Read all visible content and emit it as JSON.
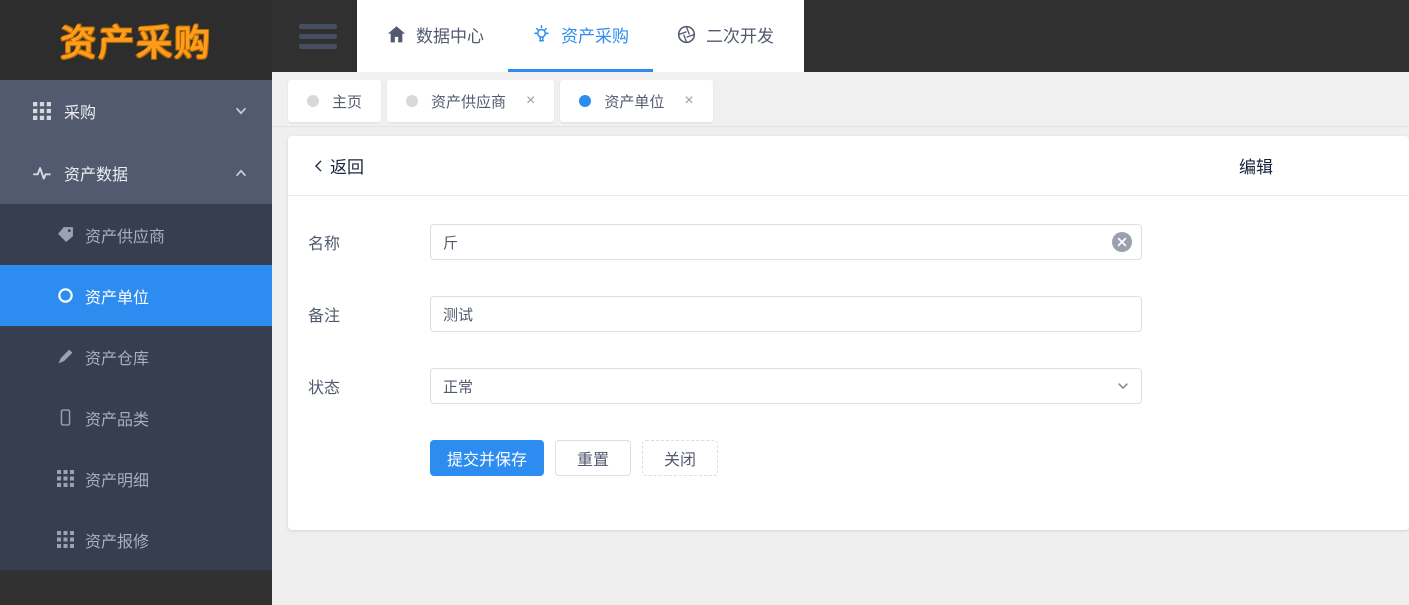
{
  "app": {
    "logo_text": "资产采购"
  },
  "colors": {
    "accent_blue": "#2d8cf0",
    "logo_orange": "#ff9c1c",
    "sidebar_bg": "#515a6e",
    "submenu_bg": "#363e4f",
    "topbar_bg": "#303030",
    "content_bg": "#efefef"
  },
  "topnav": {
    "items": [
      {
        "icon": "home-icon",
        "label": "数据中心",
        "active": false
      },
      {
        "icon": "bulb-icon",
        "label": "资产采购",
        "active": true
      },
      {
        "icon": "aperture-icon",
        "label": "二次开发",
        "active": false
      }
    ]
  },
  "sidebar": {
    "groups": [
      {
        "icon": "grid-icon",
        "label": "采购",
        "state": "collapsed"
      },
      {
        "icon": "pulse-icon",
        "label": "资产数据",
        "state": "expanded"
      }
    ],
    "submenu": [
      {
        "icon": "tag-icon",
        "label": "资产供应商",
        "active": false
      },
      {
        "icon": "circle-icon",
        "label": "资产单位",
        "active": true
      },
      {
        "icon": "pen-icon",
        "label": "资产仓库",
        "active": false
      },
      {
        "icon": "phone-icon",
        "label": "资产品类",
        "active": false
      },
      {
        "icon": "grid-icon",
        "label": "资产明细",
        "active": false
      },
      {
        "icon": "grid-icon",
        "label": "资产报修",
        "active": false
      }
    ]
  },
  "tabbar": {
    "close_glyph": "×",
    "tabs": [
      {
        "label": "主页",
        "active": false,
        "closable": false
      },
      {
        "label": "资产供应商",
        "active": false,
        "closable": true
      },
      {
        "label": "资产单位",
        "active": true,
        "closable": true
      }
    ]
  },
  "panel": {
    "back_label": "返回",
    "edit_label": "编辑"
  },
  "form": {
    "fields": [
      {
        "label": "名称",
        "value": "斤",
        "type": "text-clearable"
      },
      {
        "label": "备注",
        "value": "测试",
        "type": "text"
      },
      {
        "label": "状态",
        "value": "正常",
        "type": "select"
      }
    ],
    "buttons": [
      {
        "label": "提交并保存",
        "variant": "primary"
      },
      {
        "label": "重置",
        "variant": "default"
      },
      {
        "label": "关闭",
        "variant": "dashed"
      }
    ]
  }
}
